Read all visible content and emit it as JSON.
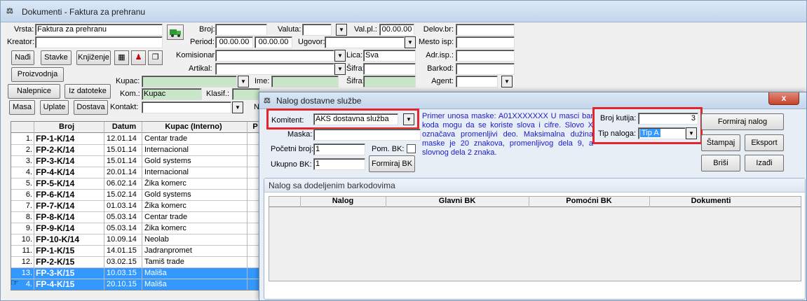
{
  "window": {
    "title": "Dokumenti - Faktura za prehranu",
    "icon": "scales-icon"
  },
  "form": {
    "vrsta": {
      "label": "Vrsta:",
      "value": "Faktura za prehranu"
    },
    "kreator": {
      "label": "Kreator:",
      "value": ""
    },
    "broj": {
      "label": "Broj:",
      "value": ""
    },
    "valuta": {
      "label": "Valuta:",
      "value": ""
    },
    "val_pl": {
      "label": "Val.pl.:",
      "value": "00.00.00"
    },
    "delov_br": {
      "label": "Delov.br:",
      "value": ""
    },
    "period": {
      "label": "Period:",
      "from": "00.00.00",
      "to": "00.00.00"
    },
    "ugovor": {
      "label": "Ugovor:",
      "value": ""
    },
    "mesto_isp": {
      "label": "Mesto isp:",
      "value": ""
    },
    "komisionar": {
      "label": "Komisionar:",
      "value": ""
    },
    "lica": {
      "label": "Lica:",
      "value": "Sva"
    },
    "adr_isp": {
      "label": "Adr.isp.:",
      "value": ""
    },
    "artikal": {
      "label": "Artikal:",
      "value": ""
    },
    "sifra1": {
      "label": "Šifra:",
      "value": ""
    },
    "barkod": {
      "label": "Barkod:",
      "value": ""
    },
    "kupac": {
      "label": "Kupac:",
      "value": ""
    },
    "ime": {
      "label": "Ime:",
      "value": ""
    },
    "sifra2": {
      "label": "Šifra:",
      "value": ""
    },
    "agent": {
      "label": "Agent:",
      "value": ""
    },
    "kom": {
      "label": "Kom.:",
      "value": "Kupac"
    },
    "klasif": {
      "label": "Klasif.:",
      "value": ""
    },
    "kontakt": {
      "label": "Kontakt:",
      "value": ""
    },
    "n_label": "N"
  },
  "buttons": {
    "nadji": "Nađi",
    "stavke": "Stavke",
    "knjizenje": "Knjiženje",
    "proizvodnja": "Proizvodnja",
    "nalepnice": "Nalepnice",
    "iz_datoteke": "Iz datoteke",
    "masa": "Masa",
    "uplate": "Uplate",
    "dostava": "Dostava"
  },
  "grid": {
    "columns": [
      "Broj",
      "Datum",
      "Kupac (Interno)",
      "P"
    ],
    "rows": [
      {
        "n": "1.",
        "broj": "FP-1-K/14",
        "datum": "12.01.14",
        "kupac": "Centar trade",
        "selected": false
      },
      {
        "n": "2.",
        "broj": "FP-2-K/14",
        "datum": "15.01.14",
        "kupac": "Internacional",
        "selected": false
      },
      {
        "n": "3.",
        "broj": "FP-3-K/14",
        "datum": "15.01.14",
        "kupac": "Gold systems",
        "selected": false
      },
      {
        "n": "4.",
        "broj": "FP-4-K/14",
        "datum": "20.01.14",
        "kupac": "Internacional",
        "selected": false
      },
      {
        "n": "5.",
        "broj": "FP-5-K/14",
        "datum": "06.02.14",
        "kupac": "Žika komerc",
        "selected": false
      },
      {
        "n": "6.",
        "broj": "FP-6-K/14",
        "datum": "15.02.14",
        "kupac": "Gold systems",
        "selected": false
      },
      {
        "n": "7.",
        "broj": "FP-7-K/14",
        "datum": "01.03.14",
        "kupac": "Žika komerc",
        "selected": false
      },
      {
        "n": "8.",
        "broj": "FP-8-K/14",
        "datum": "05.03.14",
        "kupac": "Centar trade",
        "selected": false
      },
      {
        "n": "9.",
        "broj": "FP-9-K/14",
        "datum": "05.03.14",
        "kupac": "Žika komerc",
        "selected": false
      },
      {
        "n": "10.",
        "broj": "FP-10-K/14",
        "datum": "10.09.14",
        "kupac": "Neolab",
        "selected": false
      },
      {
        "n": "11.",
        "broj": "FP-1-K/15",
        "datum": "14.01.15",
        "kupac": "Jadranpromet",
        "selected": false
      },
      {
        "n": "12.",
        "broj": "FP-2-K/15",
        "datum": "03.02.15",
        "kupac": "Tamiš trade",
        "selected": false
      },
      {
        "n": "13.",
        "broj": "FP-3-K/15",
        "datum": "10.03.15",
        "kupac": "Mališa",
        "selected": true
      },
      {
        "n": "4.",
        "broj": "FP-4-K/15",
        "datum": "20.10.15",
        "kupac": "Mališa",
        "selected": true
      }
    ]
  },
  "dialog": {
    "title": "Nalog dostavne službe",
    "close": "x",
    "komitent": {
      "label": "Komitent:",
      "value": "AKS dostavna služba"
    },
    "maska": {
      "label": "Maska:",
      "value": ""
    },
    "pocetni_broj": {
      "label": "Početni broj:",
      "value": "1"
    },
    "pom_bk": {
      "label": "Pom. BK:"
    },
    "ukupno_bk": {
      "label": "Ukupno BK:",
      "value": "1"
    },
    "formiraj_bk": "Formiraj BK",
    "note": "Primer unosa maske: A01XXXXXXX U masci bar koda mogu da se koriste slova i cifre. Slovo X označava promenljivi deo. Maksimalna dužina maske je 20 znakova, promenljivog dela 9, a slovnog dela 2 znaka.",
    "broj_kutija": {
      "label": "Broj kutija:",
      "value": "3"
    },
    "tip_naloga": {
      "label": "Tip naloga:",
      "value": "Tip A"
    },
    "buttons": {
      "formiraj_nalog": "Formiraj nalog",
      "stampaj": "Štampaj",
      "eksport": "Eksport",
      "brisi": "Briši",
      "izadji": "Izađi"
    },
    "panel_title": "Nalog sa dodeljenim barkodovima",
    "columns": [
      "Nalog",
      "Glavni BK",
      "Pomoćni BK",
      "Dokumenti"
    ]
  }
}
